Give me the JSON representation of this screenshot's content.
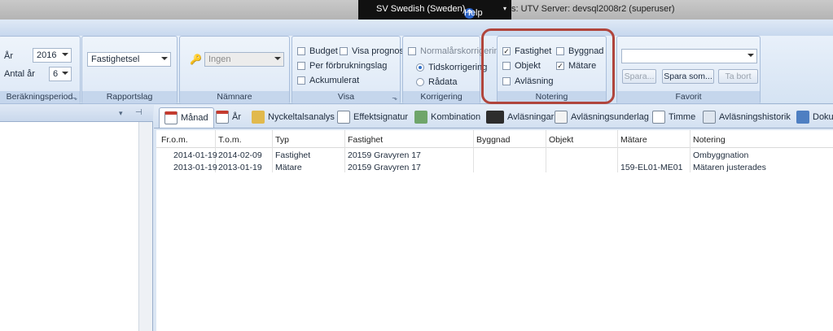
{
  "titlebar": {
    "language": "SV Swedish (Sweden)",
    "help": "Help",
    "server": "s: UTV Server: devsql2008r2 (superuser)"
  },
  "ribbon": {
    "berakning": {
      "title": "Beräkningsperiod",
      "ar_label": "År",
      "ar_value": "2016",
      "antal_label": "Antal år",
      "antal_value": "6"
    },
    "rapportslag": {
      "title": "Rapportslag",
      "value": "Fastighetsel"
    },
    "namnare": {
      "title": "Nämnare",
      "value": "Ingen"
    },
    "visa": {
      "title": "Visa",
      "budget": "Budget",
      "visa_prognos": "Visa prognos",
      "per_forbrukningslag": "Per förbrukningslag",
      "ackumulerat": "Ackumulerat"
    },
    "korrigering": {
      "title": "Korrigering",
      "normalarskorrigering": "Normalårskorrigering",
      "tidskorrigering": "Tidskorrigering",
      "radata": "Rådata"
    },
    "notering": {
      "title": "Notering",
      "fastighet": "Fastighet",
      "byggnad": "Byggnad",
      "objekt": "Objekt",
      "matare": "Mätare",
      "avlasning": "Avläsning"
    },
    "favorit": {
      "title": "Favorit",
      "spara": "Spara...",
      "spara_som": "Spara som...",
      "ta_bort": "Ta bort"
    }
  },
  "tabs": [
    "Månad",
    "År",
    "Nyckeltalsanalys",
    "Effektsignatur",
    "Kombination",
    "Avläsningar",
    "Avläsningsunderlag",
    "Timme",
    "Avläsningshistorik",
    "Doku"
  ],
  "grid": {
    "columns": [
      "Fr.o.m.",
      "T.o.m.",
      "Typ",
      "Fastighet",
      "Byggnad",
      "Objekt",
      "Mätare",
      "Notering"
    ],
    "rows": [
      [
        "2014-01-19",
        "2014-02-09",
        "Fastighet",
        "20159 Gravyren 17",
        "",
        "",
        "",
        "Ombyggnation"
      ],
      [
        "2013-01-19",
        "2013-01-19",
        "Mätare",
        "20159 Gravyren 17",
        "",
        "",
        "159-EL01-ME01",
        "Mätaren justerades"
      ]
    ]
  }
}
